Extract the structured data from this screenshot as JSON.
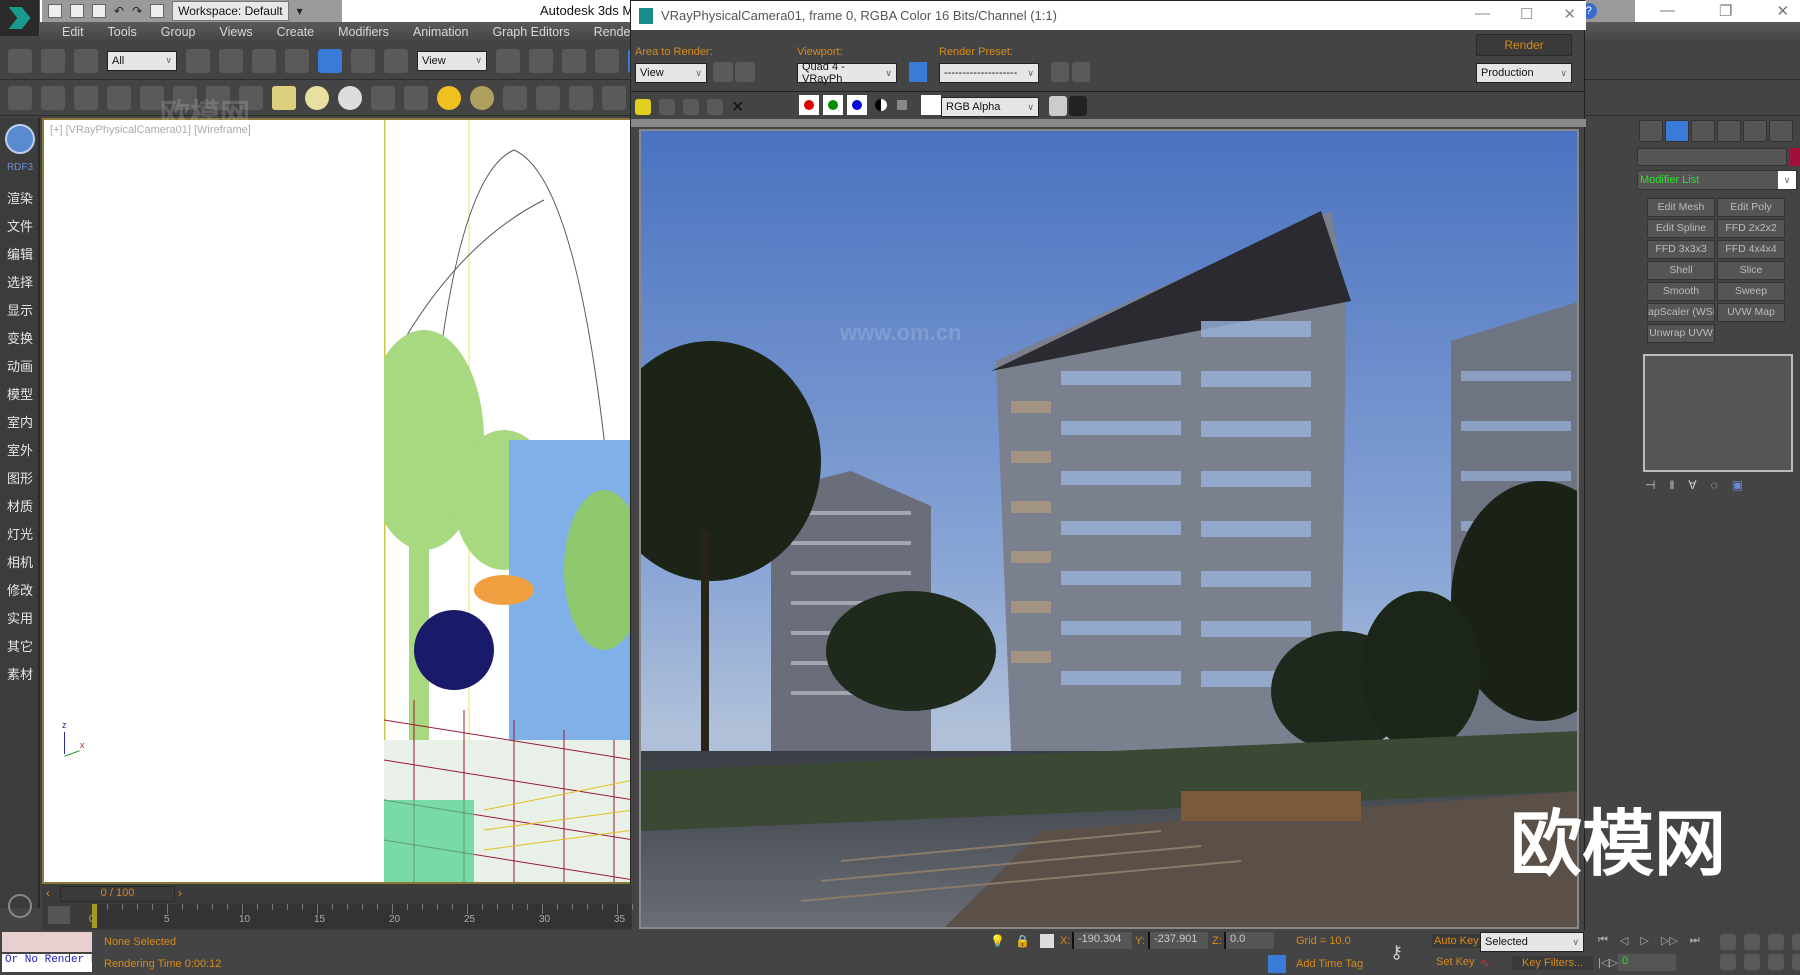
{
  "app": {
    "title": "Autodesk 3ds M",
    "workspace": "Workspace: Default",
    "menu": [
      "Edit",
      "Tools",
      "Group",
      "Views",
      "Create",
      "Modifiers",
      "Animation",
      "Graph Editors",
      "Rendering"
    ],
    "window_controls": [
      "minimize",
      "restore",
      "close"
    ]
  },
  "toolbar": {
    "selection_filter": "All",
    "ref_coord": "View"
  },
  "sidebar": {
    "brand": "RDF3",
    "items": [
      "渲染",
      "文件",
      "编辑",
      "选择",
      "显示",
      "变换",
      "动画",
      "模型",
      "室内",
      "室外",
      "图形",
      "材质",
      "灯光",
      "相机",
      "修改",
      "实用",
      "其它",
      "素材"
    ]
  },
  "viewport": {
    "label": "[+] [VRayPhysicalCamera01] [Wireframe]",
    "axis": {
      "z": "z",
      "x": "x"
    }
  },
  "render_window": {
    "title": "VRayPhysicalCamera01, frame 0, RGBA Color 16 Bits/Channel (1:1)",
    "area_label": "Area to Render:",
    "area_value": "View",
    "viewport_label": "Viewport:",
    "viewport_value": "Quad 4 - VRayPh",
    "preset_label": "Render Preset:",
    "preset_value": "--------------------",
    "render_button": "Render",
    "mode_value": "Production",
    "channel_value": "RGB Alpha",
    "channel_colors": {
      "red": "#e00000",
      "green": "#009000",
      "blue": "#0000e0"
    }
  },
  "command_panel": {
    "modifier_list": "Modifier List",
    "color_swatch": "#a0103a",
    "modifiers": [
      "Edit Mesh",
      "Edit Poly",
      "Edit Spline",
      "FFD 2x2x2",
      "FFD 3x3x3",
      "FFD 4x4x4",
      "Shell",
      "Slice",
      "Smooth",
      "Sweep",
      "apScaler (WSM",
      "UVW Map",
      "Unwrap UVW"
    ]
  },
  "timeline": {
    "frame_counter": "0 / 100",
    "ticks": [
      "0",
      "5",
      "10",
      "15",
      "20",
      "25",
      "30",
      "35"
    ]
  },
  "status": {
    "maxscript_text": "Or No Render E",
    "selection": "None Selected",
    "render_time": "Rendering Time  0:00:12",
    "x_label": "X:",
    "x_value": "-190.304",
    "y_label": "Y:",
    "y_value": "-237.901",
    "z_label": "Z:",
    "z_value": "0.0",
    "grid": "Grid = 10.0",
    "add_time_tag": "Add Time Tag",
    "auto_key": "Auto Key",
    "set_key": "Set Key",
    "key_mode": "Selected",
    "key_filters": "Key Filters...",
    "current_frame": "0"
  },
  "watermark": {
    "brand": "欧模网",
    "url": "www.om.cn"
  }
}
